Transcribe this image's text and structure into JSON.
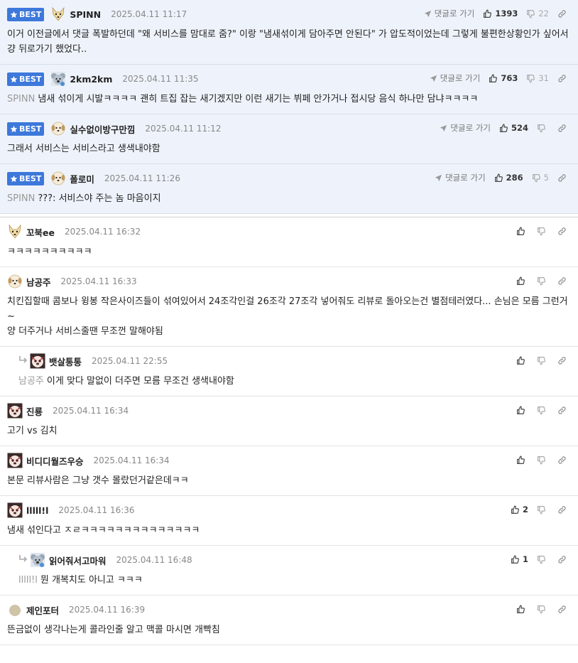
{
  "best_label": "BEST",
  "go_to_comment_label": "댓글로 가기",
  "colors": {
    "best_badge": "#3d78db",
    "best_bg": "#eef3fb"
  },
  "comments": [
    {
      "best": true,
      "avatar": "dog",
      "nick": "SPINN",
      "date": "2025.04.11 11:17",
      "up": "1393",
      "down": "22",
      "mention": "",
      "text": "이거 이전글에서 댓글 폭발하던데 \"왜 서비스를 맘대로 줌?\" 이랑 \"냄새섞이게 담아주면 안된다\" 가 압도적이었는데 그렇게 불편한상황인가 싶어서 걍 뒤로가기 했었다.."
    },
    {
      "best": true,
      "avatar": "koala",
      "nick": "2km2km",
      "date": "2025.04.11 11:35",
      "up": "763",
      "down": "31",
      "mention": "SPINN",
      "text": "냄새 섞이게 시발ㅋㅋㅋㅋ 괜히 트집 잡는 새기겠지만 이런 새기는 뷔페 안가거나 접시당 음식 하나만 담냐ㅋㅋㅋㅋ"
    },
    {
      "best": true,
      "avatar": "puppy",
      "nick": "실수없이방구만낌",
      "date": "2025.04.11 11:12",
      "up": "524",
      "down": "",
      "mention": "",
      "text": "그래서 서비스는 서비스라고 생색내야함"
    },
    {
      "best": true,
      "avatar": "puppy",
      "nick": "폴로미",
      "date": "2025.04.11 11:26",
      "up": "286",
      "down": "5",
      "mention": "SPINN",
      "text": "???: 서비스야 주는 놈 마음이지"
    },
    {
      "best": false,
      "avatar": "dog",
      "nick": "꼬북ee",
      "date": "2025.04.11 16:32",
      "up": "",
      "down": "",
      "mention": "",
      "text": "ㅋㅋㅋㅋㅋㅋㅋㅋㅋㅋ"
    },
    {
      "best": false,
      "avatar": "puppy",
      "nick": "남공주",
      "date": "2025.04.11 16:33",
      "up": "",
      "down": "",
      "mention": "",
      "text": "치킨집할때 콤보나 윙봉 작은사이즈들이 섞여있어서 24조각인걸 26조각 27조각 넣어줘도 리뷰로 돌아오는건 별점테러였다... 손님은 모름 그런거~\n양 더주거나 서비스줄땐 무조껀 말해야됨"
    },
    {
      "best": false,
      "reply": true,
      "avatar": "pug",
      "nick": "뱃살통통",
      "date": "2025.04.11 22:55",
      "up": "",
      "down": "",
      "mention": "남공주",
      "text": "이게 맞다 말없이 더주면 모름 무조건 생색내야함"
    },
    {
      "best": false,
      "avatar": "pug",
      "nick": "진룡",
      "date": "2025.04.11 16:34",
      "up": "",
      "down": "",
      "mention": "",
      "text": "고기 vs 김치"
    },
    {
      "best": false,
      "avatar": "pug",
      "nick": "비디디월즈우승",
      "date": "2025.04.11 16:34",
      "up": "",
      "down": "",
      "mention": "",
      "text": "본문 리뷰사람은 그냥 갯수 몰랐던거같은데ㅋㅋ"
    },
    {
      "best": false,
      "avatar": "pug",
      "nick": "lllll!l",
      "date": "2025.04.11 16:36",
      "up": "2",
      "down": "",
      "mention": "",
      "text": "냄새 섞인다고 ㅈㄹㅋㅋㅋㅋㅋㅋㅋㅋㅋㅋㅋㅋㅋㅋ"
    },
    {
      "best": false,
      "reply": true,
      "avatar": "koala",
      "nick": "읽어줘서고마워",
      "date": "2025.04.11 16:48",
      "up": "1",
      "down": "",
      "mention": "lllll!l",
      "text": "뭔 개복치도 아니고 ㅋㅋㅋ"
    },
    {
      "best": false,
      "avatar": "dot",
      "nick": "제인포터",
      "date": "2025.04.11 16:39",
      "up": "",
      "down": "",
      "mention": "",
      "text": "뜬금없이 생각나는게 콜라인줄 알고 맥콜 마시면 개빡침"
    }
  ]
}
